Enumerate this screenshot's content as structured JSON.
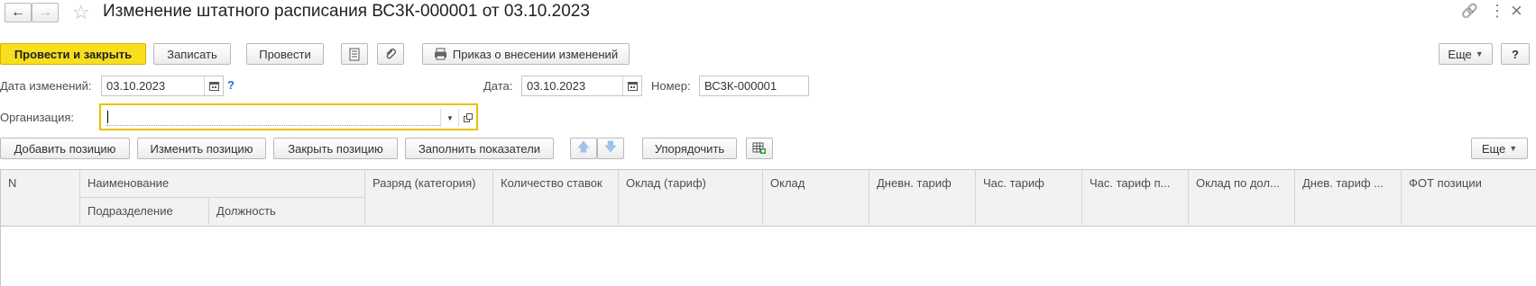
{
  "window": {
    "title": "Изменение штатного расписания ВС3К-000001 от 03.10.2023",
    "nav_back": "←",
    "nav_forward": "→",
    "star": "☆",
    "link": "🔗",
    "more": "⋮",
    "close": "×"
  },
  "toolbar": {
    "post_close": "Провести и закрыть",
    "save": "Записать",
    "post": "Провести",
    "order": "Приказ о внесении изменений",
    "more": "Еще",
    "help": "?"
  },
  "form": {
    "change_date_label": "Дата изменений:",
    "change_date_value": "03.10.2023",
    "help_mark": "?",
    "date_label": "Дата:",
    "date_value": "03.10.2023",
    "number_label": "Номер:",
    "number_value": "ВС3К-000001",
    "org_label": "Организация:",
    "org_value": ""
  },
  "table_toolbar": {
    "add": "Добавить позицию",
    "edit": "Изменить позицию",
    "close": "Закрыть позицию",
    "fill": "Заполнить показатели",
    "up": "🡅",
    "down": "🡇",
    "sort": "Упорядочить",
    "more": "Еще"
  },
  "table": {
    "col_n": "N",
    "col_name": "Наименование",
    "col_dept": "Подразделение",
    "col_position": "Должность",
    "col_grade": "Разряд (категория)",
    "col_rates": "Количество ставок",
    "col_salary_tariff": "Оклад (тариф)",
    "col_salary": "Оклад",
    "col_day_tariff": "Дневн. тариф",
    "col_hour_tariff": "Час. тариф",
    "col_hour_tariff2": "Час. тариф п...",
    "col_salary_by": "Оклад по дол...",
    "col_day_tariff2": "Днев. тариф ...",
    "col_fot": "ФОТ позиции"
  },
  "colors": {
    "primary_button": "#f7df1e",
    "focus_border": "#e8c000",
    "help_blue": "#1f6fc5",
    "table_header": "#f2f2f2"
  }
}
